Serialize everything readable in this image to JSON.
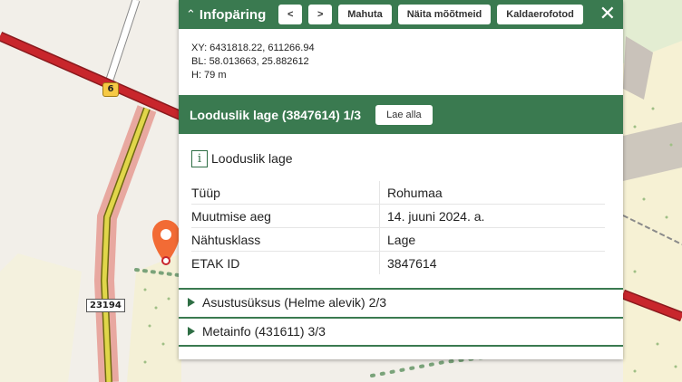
{
  "map": {
    "road_shield": "6",
    "road_number": "23194"
  },
  "panel": {
    "title": "Infopäring",
    "buttons": {
      "prev": "<",
      "next": ">",
      "fit": "Mahuta",
      "show_measurements": "Näita mõõtmeid",
      "oblique_photos": "Kaldaerofotod"
    },
    "coords": {
      "xy": "XY: 6431818.22, 611266.94",
      "bl": "BL: 58.013663, 25.882612",
      "h": "H: 79 m"
    },
    "layer": {
      "title": "Looduslik lage (3847614) 1/3",
      "download": "Lae alla"
    },
    "feature": {
      "icon": "info-icon",
      "name": "Looduslik lage",
      "attributes": [
        {
          "key": "Tüüp",
          "value": "Rohumaa"
        },
        {
          "key": "Muutmise aeg",
          "value": "14. juuni 2024. a."
        },
        {
          "key": "Nähtusklass",
          "value": "Lage"
        },
        {
          "key": "ETAK ID",
          "value": "3847614"
        }
      ]
    },
    "sections": [
      {
        "label": "Asustusüksus (Helme alevik) 2/3"
      },
      {
        "label": "Metainfo (431611) 3/3"
      }
    ]
  },
  "colors": {
    "panel_green": "#3a7a50",
    "pin": "#f26b35",
    "road_main": "#c8262c"
  }
}
